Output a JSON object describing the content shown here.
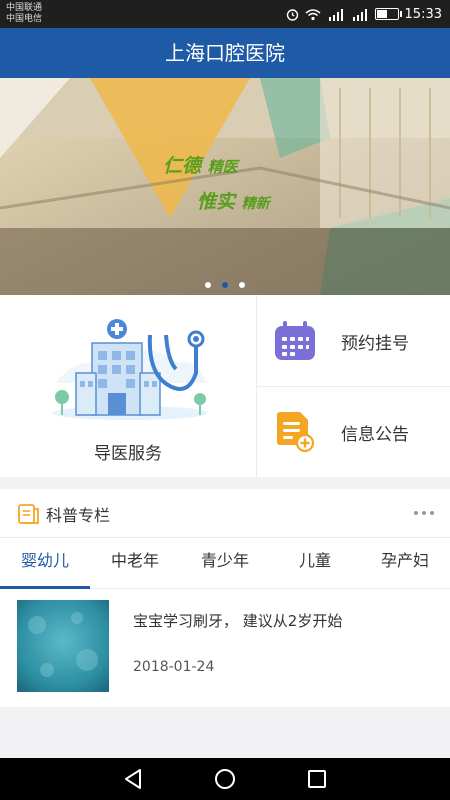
{
  "status_bar": {
    "carrier1": "中国联通",
    "carrier2": "中国电信",
    "time": "15:33",
    "battery_level": 0.55
  },
  "header": {
    "title": "上海口腔医院"
  },
  "banner": {
    "slide_count": 3,
    "active_slide": 2,
    "motto": [
      "仁德",
      "精医",
      "惟实",
      "精新"
    ]
  },
  "services": {
    "guide": {
      "label": "导医服务",
      "icon": "hospital-stethoscope-icon"
    },
    "appointment": {
      "label": "预约挂号",
      "icon": "calendar-icon",
      "color": "#7b6fd8"
    },
    "notice": {
      "label": "信息公告",
      "icon": "document-icon",
      "color": "#f4a623"
    }
  },
  "science": {
    "title": "科普专栏",
    "tabs": [
      "婴幼儿",
      "中老年",
      "青少年",
      "儿童",
      "孕产妇"
    ],
    "active_tab": 0,
    "articles": [
      {
        "title": "宝宝学习刷牙， 建议从2岁开始",
        "date": "2018-01-24"
      }
    ]
  },
  "colors": {
    "primary": "#1f5aa6",
    "statusbar": "#1f1f1f",
    "navbar": "#000000"
  }
}
